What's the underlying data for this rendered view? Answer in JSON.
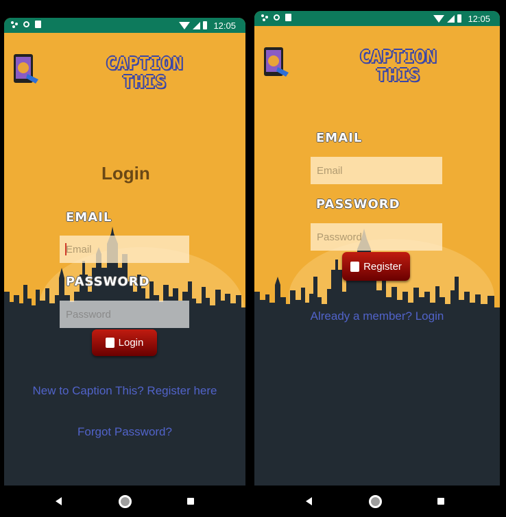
{
  "status": {
    "time": "12:05"
  },
  "brand": {
    "line1": "CAPTION",
    "line2": "THIS"
  },
  "login": {
    "title": "Login",
    "email_label": "EMAIL",
    "email_placeholder": "Email",
    "password_label": "PASSWORD",
    "password_placeholder": "Password",
    "button": "Login",
    "register_link": "New to Caption This? Register here",
    "forgot_link": "Forgot Password?"
  },
  "register": {
    "email_label": "EMAIL",
    "email_placeholder": "Email",
    "password_label": "PASSWORD",
    "password_placeholder": "Password",
    "button": "Register",
    "login_link": "Already a member? Login"
  },
  "colors": {
    "background": "#f0ad35",
    "status_bar": "#0d7a5c",
    "skyline": "#222b33",
    "button": "#a4140a",
    "link": "#5163c9"
  },
  "icons": [
    "app-logo",
    "status-icons",
    "login-icon",
    "register-icon",
    "back-icon",
    "home-icon",
    "recents-icon"
  ]
}
